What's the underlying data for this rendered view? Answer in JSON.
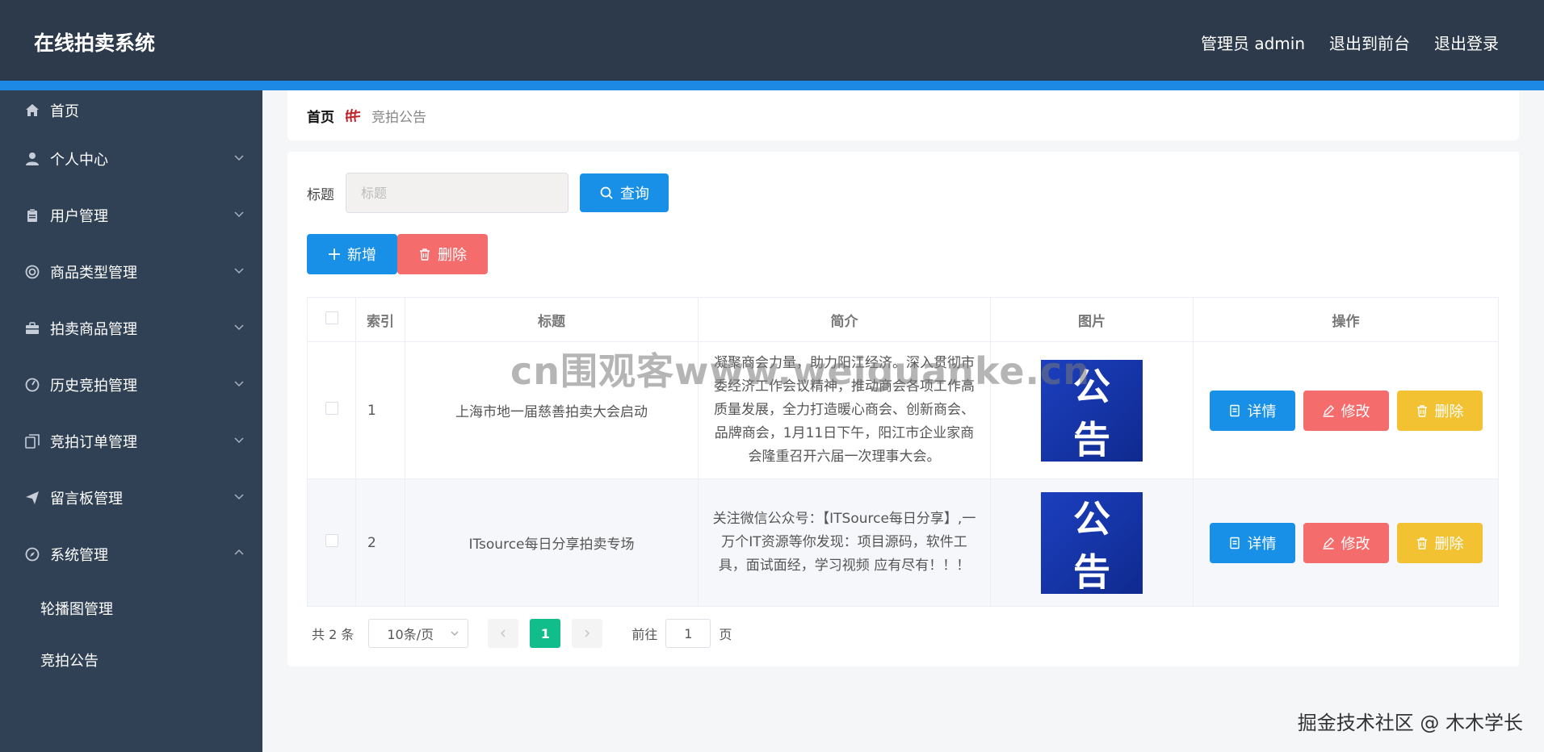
{
  "header": {
    "app_title": "在线拍卖系统",
    "admin_label": "管理员 admin",
    "exit_frontend": "退出到前台",
    "logout": "退出登录"
  },
  "sidebar": {
    "items": [
      {
        "label": "首页",
        "icon": "home-icon"
      },
      {
        "label": "个人中心",
        "icon": "user-icon"
      },
      {
        "label": "用户管理",
        "icon": "clipboard-icon"
      },
      {
        "label": "商品类型管理",
        "icon": "lifebuoy-icon"
      },
      {
        "label": "拍卖商品管理",
        "icon": "briefcase-icon"
      },
      {
        "label": "历史竞拍管理",
        "icon": "gauge-icon"
      },
      {
        "label": "竞拍订单管理",
        "icon": "copy-icon"
      },
      {
        "label": "留言板管理",
        "icon": "send-icon"
      },
      {
        "label": "系统管理",
        "icon": "compass-icon"
      }
    ],
    "sub_items": [
      {
        "label": "轮播图管理"
      },
      {
        "label": "竞拍公告"
      }
    ]
  },
  "breadcrumb": {
    "home": "首页",
    "current": "竞拍公告"
  },
  "search": {
    "label": "标题",
    "placeholder": "标题",
    "query_button": "查询"
  },
  "actions": {
    "add": "新增",
    "delete": "删除"
  },
  "table": {
    "columns": [
      "索引",
      "标题",
      "简介",
      "图片",
      "操作"
    ],
    "rows": [
      {
        "index": "1",
        "title": "上海市地一届慈善拍卖大会启动",
        "intro": "凝聚商会力量，助力阳江经济。深入贯彻市委经济工作会议精神，推动商会各项工作高质量发展，全力打造暖心商会、创新商会、品牌商会，1月11日下午，阳江市企业家商会隆重召开六届一次理事大会。",
        "image_text": "公告"
      },
      {
        "index": "2",
        "title": "ITsource每日分享拍卖专场",
        "intro": "关注微信公众号：【ITSource每日分享】,一万个IT资源等你发现：项目源码，软件工具，面试面经，学习视频 应有尽有！！！",
        "image_text": "公告"
      }
    ],
    "op_detail": "详情",
    "op_edit": "修改",
    "op_delete": "删除"
  },
  "pagination": {
    "total": "共 2 条",
    "page_size": "10条/页",
    "current_page": "1",
    "goto_label": "前往",
    "goto_value": "1",
    "goto_suffix": "页"
  },
  "watermarks": {
    "center": "cn围观客www.weiguanke.cn",
    "bottom": "掘金技术社区 @ 木木学长"
  },
  "colors": {
    "header_bg": "#2d3a4b",
    "accent_stripe": "#1e88e5",
    "sidebar_bg": "#304156",
    "primary": "#1890e8",
    "danger": "#f56c6c",
    "warning": "#f3c232",
    "pager_active": "#12bd8c"
  }
}
